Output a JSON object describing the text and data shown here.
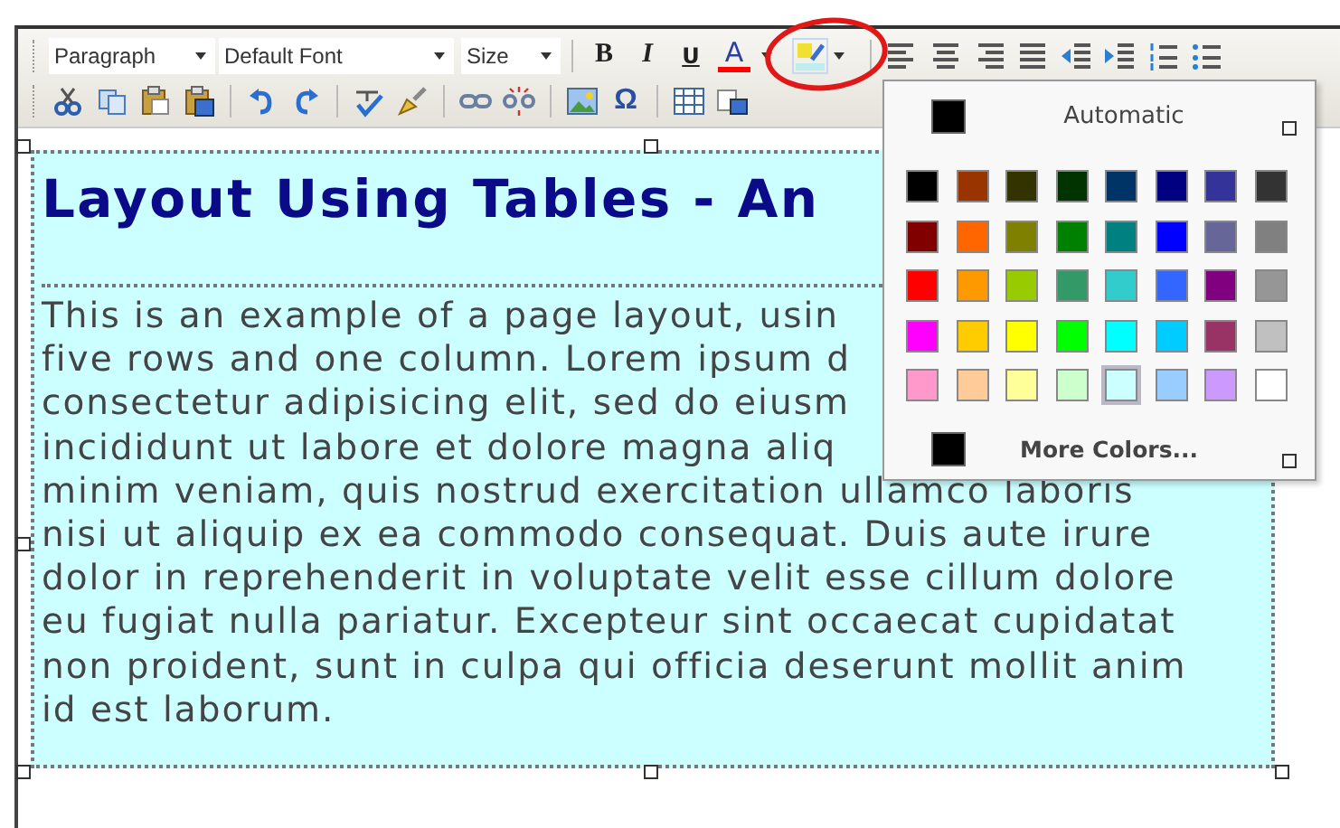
{
  "toolbar": {
    "selects": [
      {
        "value": "Paragraph"
      },
      {
        "value": "Default Font"
      },
      {
        "value": "Size"
      }
    ],
    "format_buttons": [
      {
        "kind": "bold",
        "label": "B"
      },
      {
        "kind": "italic",
        "label": "I"
      },
      {
        "kind": "underline",
        "label": "U"
      },
      {
        "kind": "fontcolor",
        "label": "A",
        "color": "#ff0000"
      }
    ],
    "highlight_button": {
      "circled": true,
      "open": true
    },
    "symbol_button": "Ω"
  },
  "document": {
    "heading": "Layout Using Tables - An",
    "paragraph_lines": [
      "This is an example of a page layout, usin",
      "five rows and one column. Lorem ipsum d",
      "consectetur adipisicing elit, sed do eiusm",
      "incididunt ut labore et dolore magna aliq",
      "minim veniam, quis nostrud exercitation ullamco laboris",
      "nisi ut aliquip ex ea commodo consequat. Duis aute irure",
      "dolor in reprehenderit in voluptate velit esse cillum dolore",
      "eu fugiat nulla pariatur. Excepteur sint occaecat cupidatat",
      "non proident, sunt in culpa qui officia deserunt mollit anim",
      "id est laborum."
    ]
  },
  "color_popup": {
    "automatic": {
      "label": "Automatic",
      "color": "#000000"
    },
    "swatches": [
      {
        "color": "#000000",
        "selected": false
      },
      {
        "color": "#993300",
        "selected": false
      },
      {
        "color": "#333300",
        "selected": false
      },
      {
        "color": "#003300",
        "selected": false
      },
      {
        "color": "#003366",
        "selected": false
      },
      {
        "color": "#000080",
        "selected": false
      },
      {
        "color": "#333399",
        "selected": false
      },
      {
        "color": "#333333",
        "selected": false
      },
      {
        "color": "#800000",
        "selected": false
      },
      {
        "color": "#ff6600",
        "selected": false
      },
      {
        "color": "#808000",
        "selected": false
      },
      {
        "color": "#008000",
        "selected": false
      },
      {
        "color": "#008080",
        "selected": false
      },
      {
        "color": "#0000ff",
        "selected": false
      },
      {
        "color": "#666699",
        "selected": false
      },
      {
        "color": "#808080",
        "selected": false
      },
      {
        "color": "#ff0000",
        "selected": false
      },
      {
        "color": "#ff9900",
        "selected": false
      },
      {
        "color": "#99cc00",
        "selected": false
      },
      {
        "color": "#339966",
        "selected": false
      },
      {
        "color": "#33cccc",
        "selected": false
      },
      {
        "color": "#3366ff",
        "selected": false
      },
      {
        "color": "#800080",
        "selected": false
      },
      {
        "color": "#969696",
        "selected": false
      },
      {
        "color": "#ff00ff",
        "selected": false
      },
      {
        "color": "#ffcc00",
        "selected": false
      },
      {
        "color": "#ffff00",
        "selected": false
      },
      {
        "color": "#00ff00",
        "selected": false
      },
      {
        "color": "#00ffff",
        "selected": false
      },
      {
        "color": "#00ccff",
        "selected": false
      },
      {
        "color": "#993366",
        "selected": false
      },
      {
        "color": "#c0c0c0",
        "selected": false
      },
      {
        "color": "#ff99cc",
        "selected": false
      },
      {
        "color": "#ffcc99",
        "selected": false
      },
      {
        "color": "#ffff99",
        "selected": false
      },
      {
        "color": "#ccffcc",
        "selected": false
      },
      {
        "color": "#ccffff",
        "selected": true
      },
      {
        "color": "#99ccff",
        "selected": false
      },
      {
        "color": "#cc99ff",
        "selected": false
      },
      {
        "color": "#ffffff",
        "selected": false
      }
    ],
    "more": {
      "label": "More Colors...",
      "color": "#000000"
    }
  }
}
